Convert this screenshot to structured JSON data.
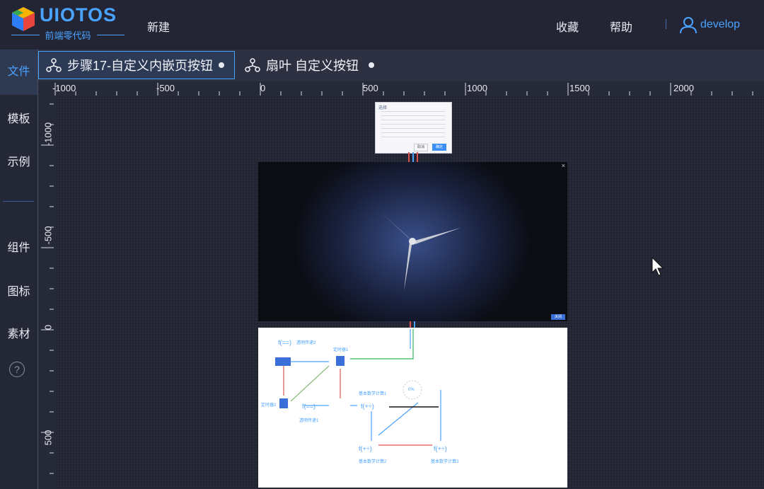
{
  "brand": {
    "name": "UIOTOS",
    "tagline": "前端零代码"
  },
  "nav": {
    "new": "新建",
    "favorites": "收藏",
    "help": "帮助",
    "user": "develop"
  },
  "sidebar": {
    "items": [
      {
        "label": "文件"
      },
      {
        "label": "模板"
      },
      {
        "label": "示例"
      },
      {
        "label": "组件"
      },
      {
        "label": "图标"
      },
      {
        "label": "素材"
      }
    ],
    "help_glyph": "?"
  },
  "tabs": [
    {
      "label": "步骤17-自定义内嵌页按钮",
      "active": true
    },
    {
      "label": "扇叶 自定义按钮",
      "active": false
    }
  ],
  "ruler": {
    "h_labels": [
      "-1000",
      "-500",
      "0",
      "500",
      "1000",
      "1500",
      "2000"
    ],
    "v_labels": [
      "-1000",
      "-500",
      "0",
      "500"
    ]
  },
  "fan_panel": {
    "close_glyph": "×",
    "button_label": "关闭"
  },
  "dialog_panel": {
    "title": "选择",
    "cancel": "取消",
    "confirm": "确定"
  },
  "flow": {
    "nodes": [
      "透明传递2",
      "定时器1",
      "定时器2",
      "透明传递1",
      "基本数学计算1",
      "基本数学计算2",
      "基本数学计算3",
      "0%"
    ]
  },
  "icons": {
    "tab": "flow-node-icon",
    "user": "user-icon",
    "help": "help-circle-icon",
    "cursor": "mouse-cursor-icon"
  },
  "colors": {
    "accent": "#4aa3ff",
    "background": "#252837",
    "panel": "#2d3040"
  }
}
